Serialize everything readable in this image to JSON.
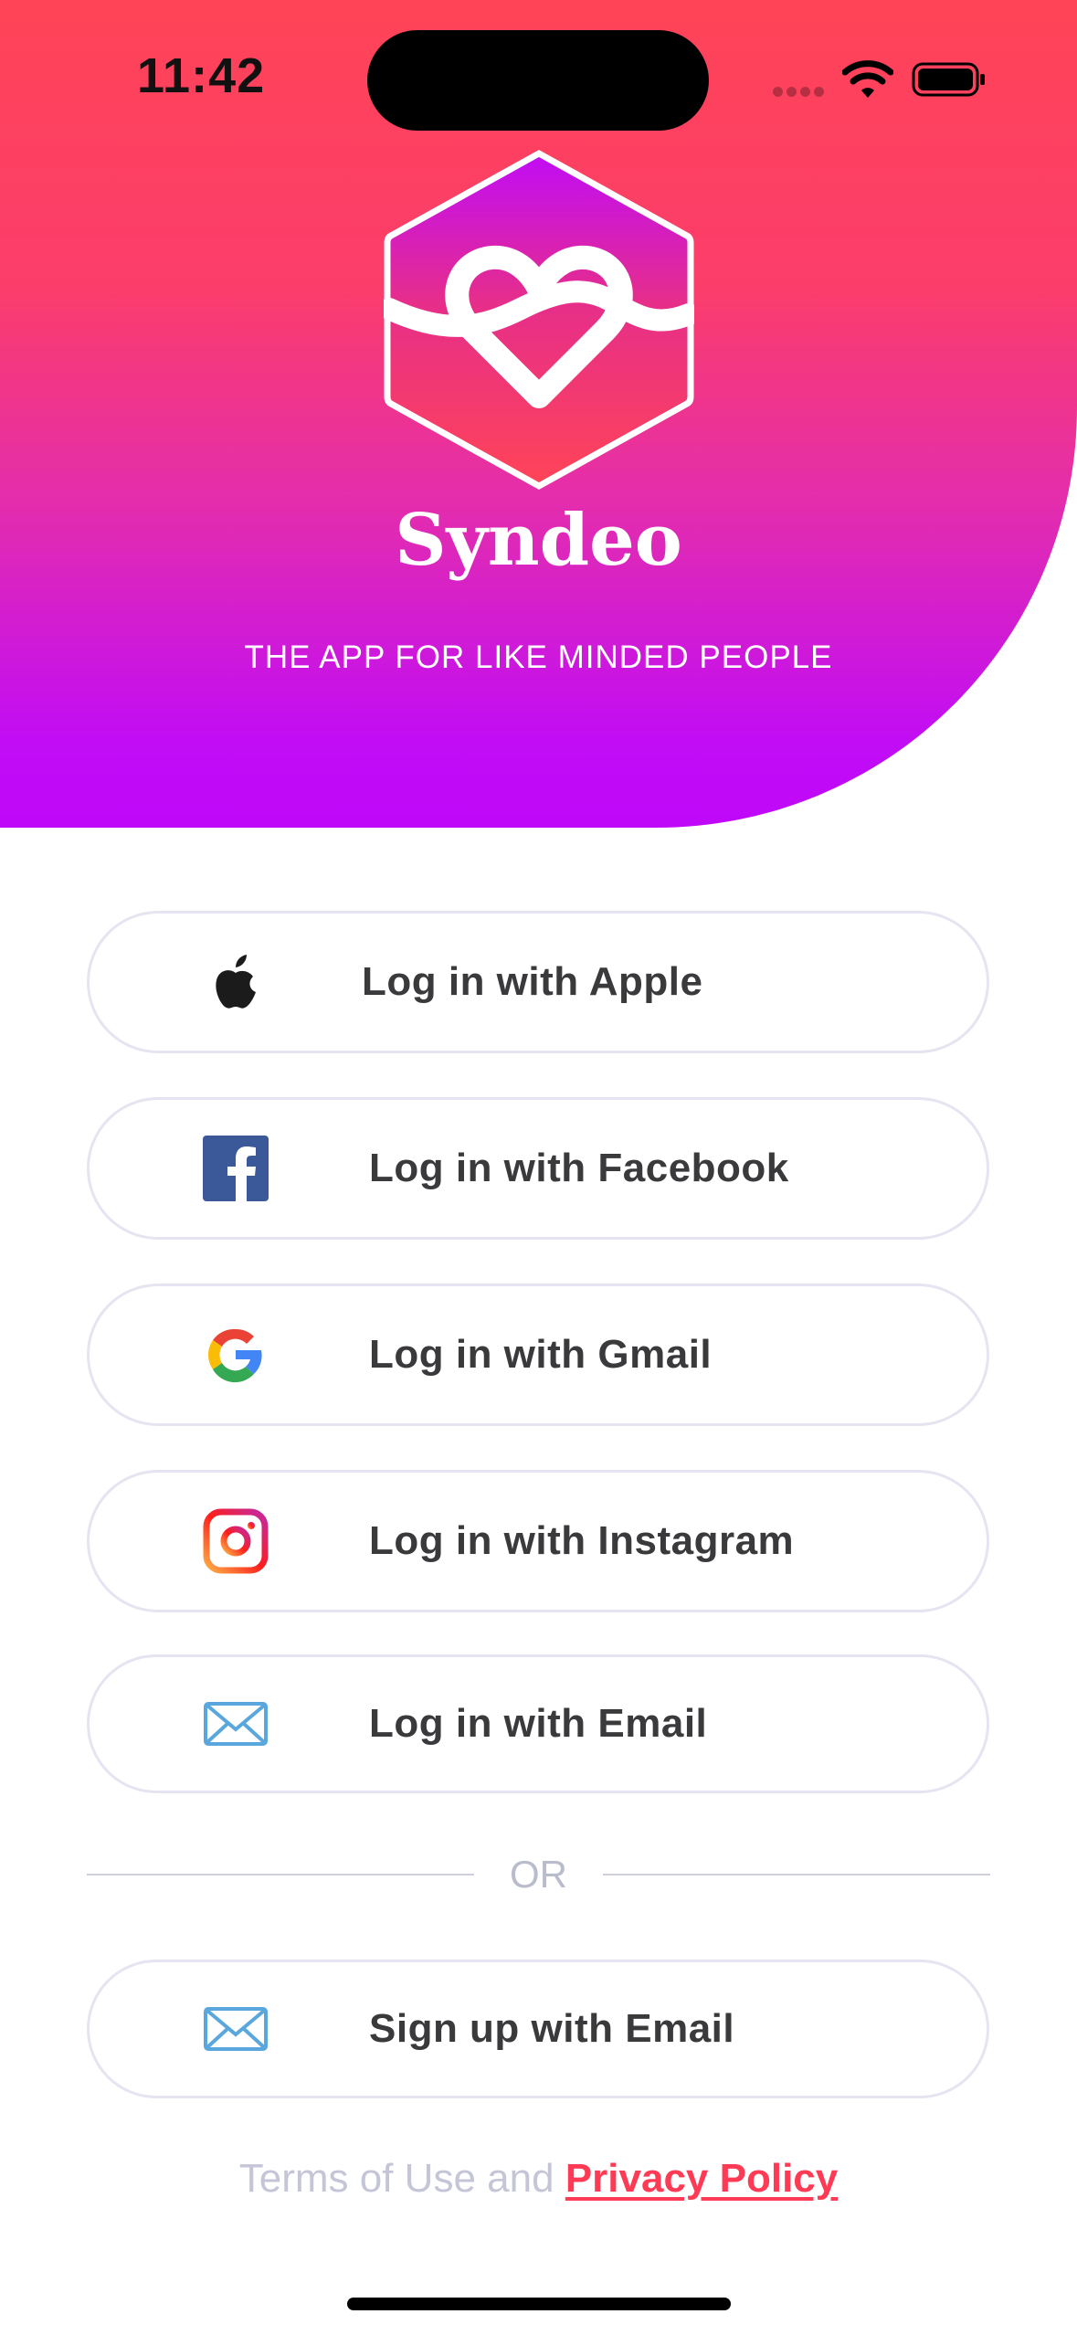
{
  "status_bar": {
    "time": "11:42"
  },
  "header": {
    "brand": "Syndeo",
    "tagline": "THE APP FOR LIKE MINDED PEOPLE"
  },
  "login_buttons": [
    {
      "label": "Log in with Apple",
      "icon": "apple-icon"
    },
    {
      "label": "Log in with Facebook",
      "icon": "facebook-icon"
    },
    {
      "label": "Log in with Gmail",
      "icon": "google-icon"
    },
    {
      "label": "Log in with Instagram",
      "icon": "instagram-icon"
    },
    {
      "label": "Log in with Email",
      "icon": "mail-icon"
    }
  ],
  "divider": {
    "text": "OR"
  },
  "signup_button": {
    "label": "Sign up with Email",
    "icon": "mail-icon"
  },
  "footer": {
    "terms_text": "Terms of Use and",
    "privacy_link": "Privacy Policy"
  },
  "colors": {
    "gradient_top": "#ff4457",
    "gradient_bottom": "#c008f8",
    "accent": "#ff3a55",
    "button_border": "#e5e4f1",
    "button_text": "#3a3a3d"
  }
}
